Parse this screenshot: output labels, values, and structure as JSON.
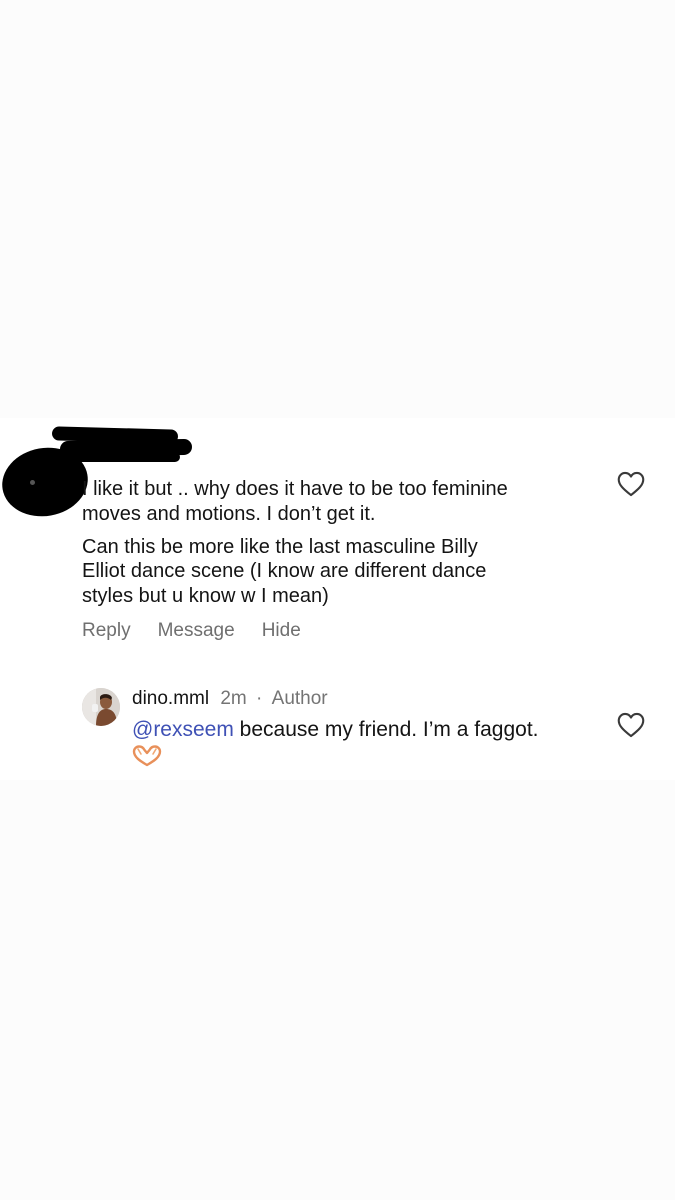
{
  "comment": {
    "username_partial": "",
    "text_lines": [
      "I like it but .. why does it have to be too feminine",
      "moves and motions. I don’t get it.",
      "Can this be more like the last masculine Billy",
      "Elliot dance scene (I know are different dance",
      "styles but u know w I mean)"
    ],
    "actions": {
      "reply": "Reply",
      "message": "Message",
      "hide": "Hide"
    },
    "like_icon": "heart-outline-icon"
  },
  "reply": {
    "username": "dino.mml",
    "time": "2m",
    "separator": "·",
    "role": "Author",
    "mention": "@rexseem",
    "text": " because my friend. I’m a faggot.",
    "emoji": "heart-hands-emoji",
    "like_icon": "heart-outline-icon"
  },
  "colors": {
    "mention": "#3f51b5",
    "secondary_text": "#6f6f6f",
    "redaction": "#000000"
  }
}
